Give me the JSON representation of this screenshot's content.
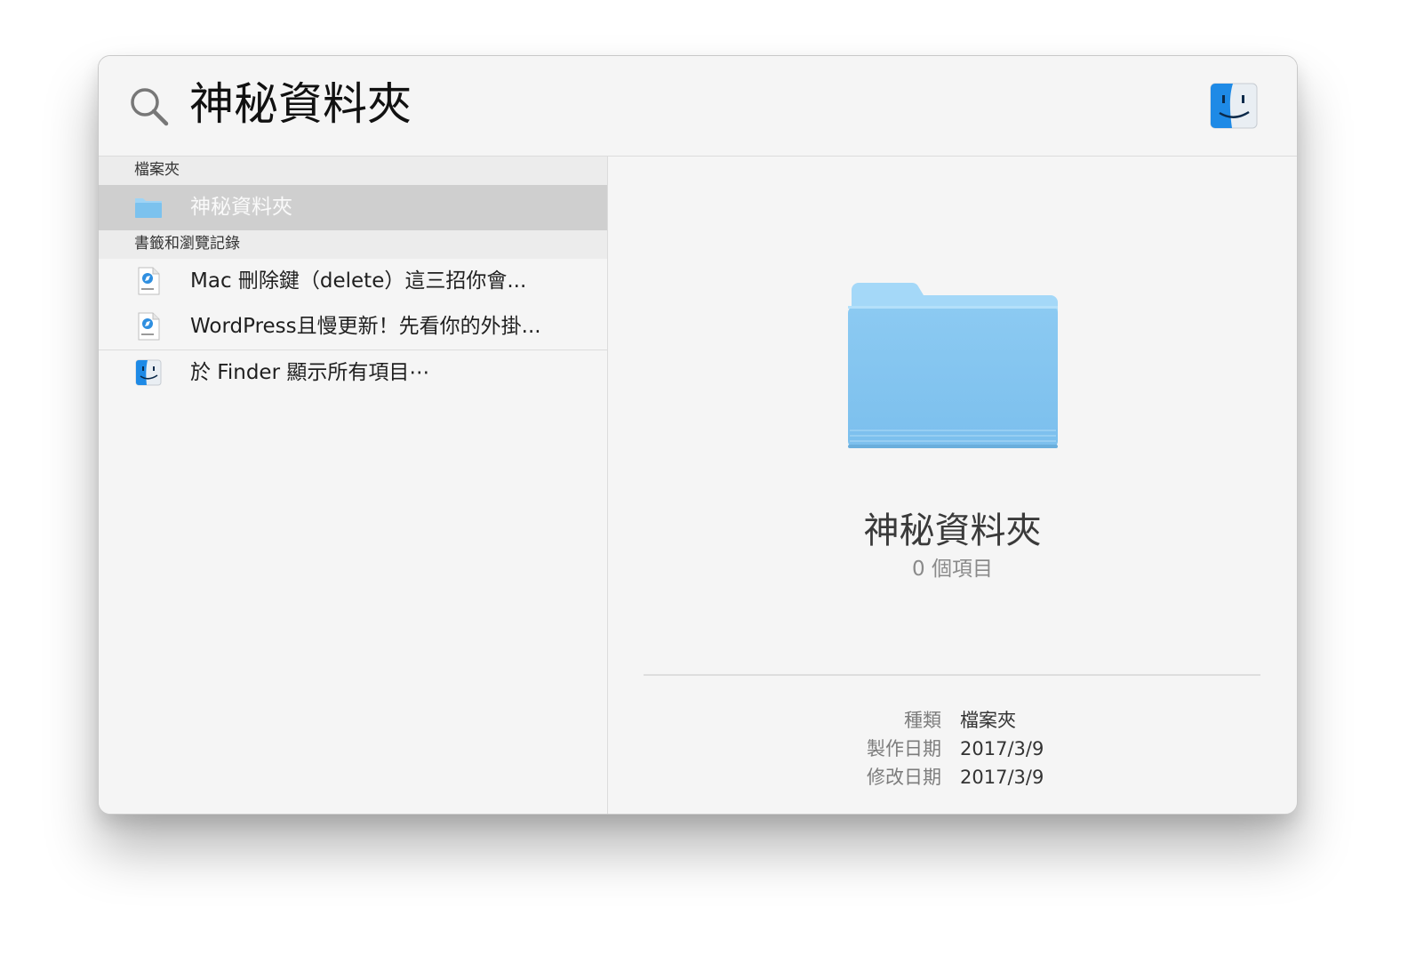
{
  "search": {
    "query": "神秘資料夾"
  },
  "results": {
    "sections": [
      {
        "header": "檔案夾",
        "items": [
          {
            "label": "神秘資料夾",
            "icon": "folder-icon",
            "selected": true
          }
        ]
      },
      {
        "header": "書籤和瀏覽記錄",
        "items": [
          {
            "label": "Mac 刪除鍵（delete）這三招你會...",
            "icon": "webloc-icon"
          },
          {
            "label": "WordPress且慢更新！先看你的外掛...",
            "icon": "webloc-icon"
          }
        ]
      }
    ],
    "finder_item": {
      "label": "於 Finder 顯示所有項目⋯",
      "icon": "finder-icon"
    }
  },
  "preview": {
    "title": "神秘資料夾",
    "count": "0 個項目",
    "meta": [
      {
        "key": "種類",
        "value": "檔案夾"
      },
      {
        "key": "製作日期",
        "value": "2017/3/9"
      },
      {
        "key": "修改日期",
        "value": "2017/3/9"
      }
    ]
  },
  "colors": {
    "folder_light": "#a9dbf8",
    "folder_main": "#7ec3ef",
    "selection": "#cfcfcf",
    "finder_blue": "#1e8ae6"
  }
}
